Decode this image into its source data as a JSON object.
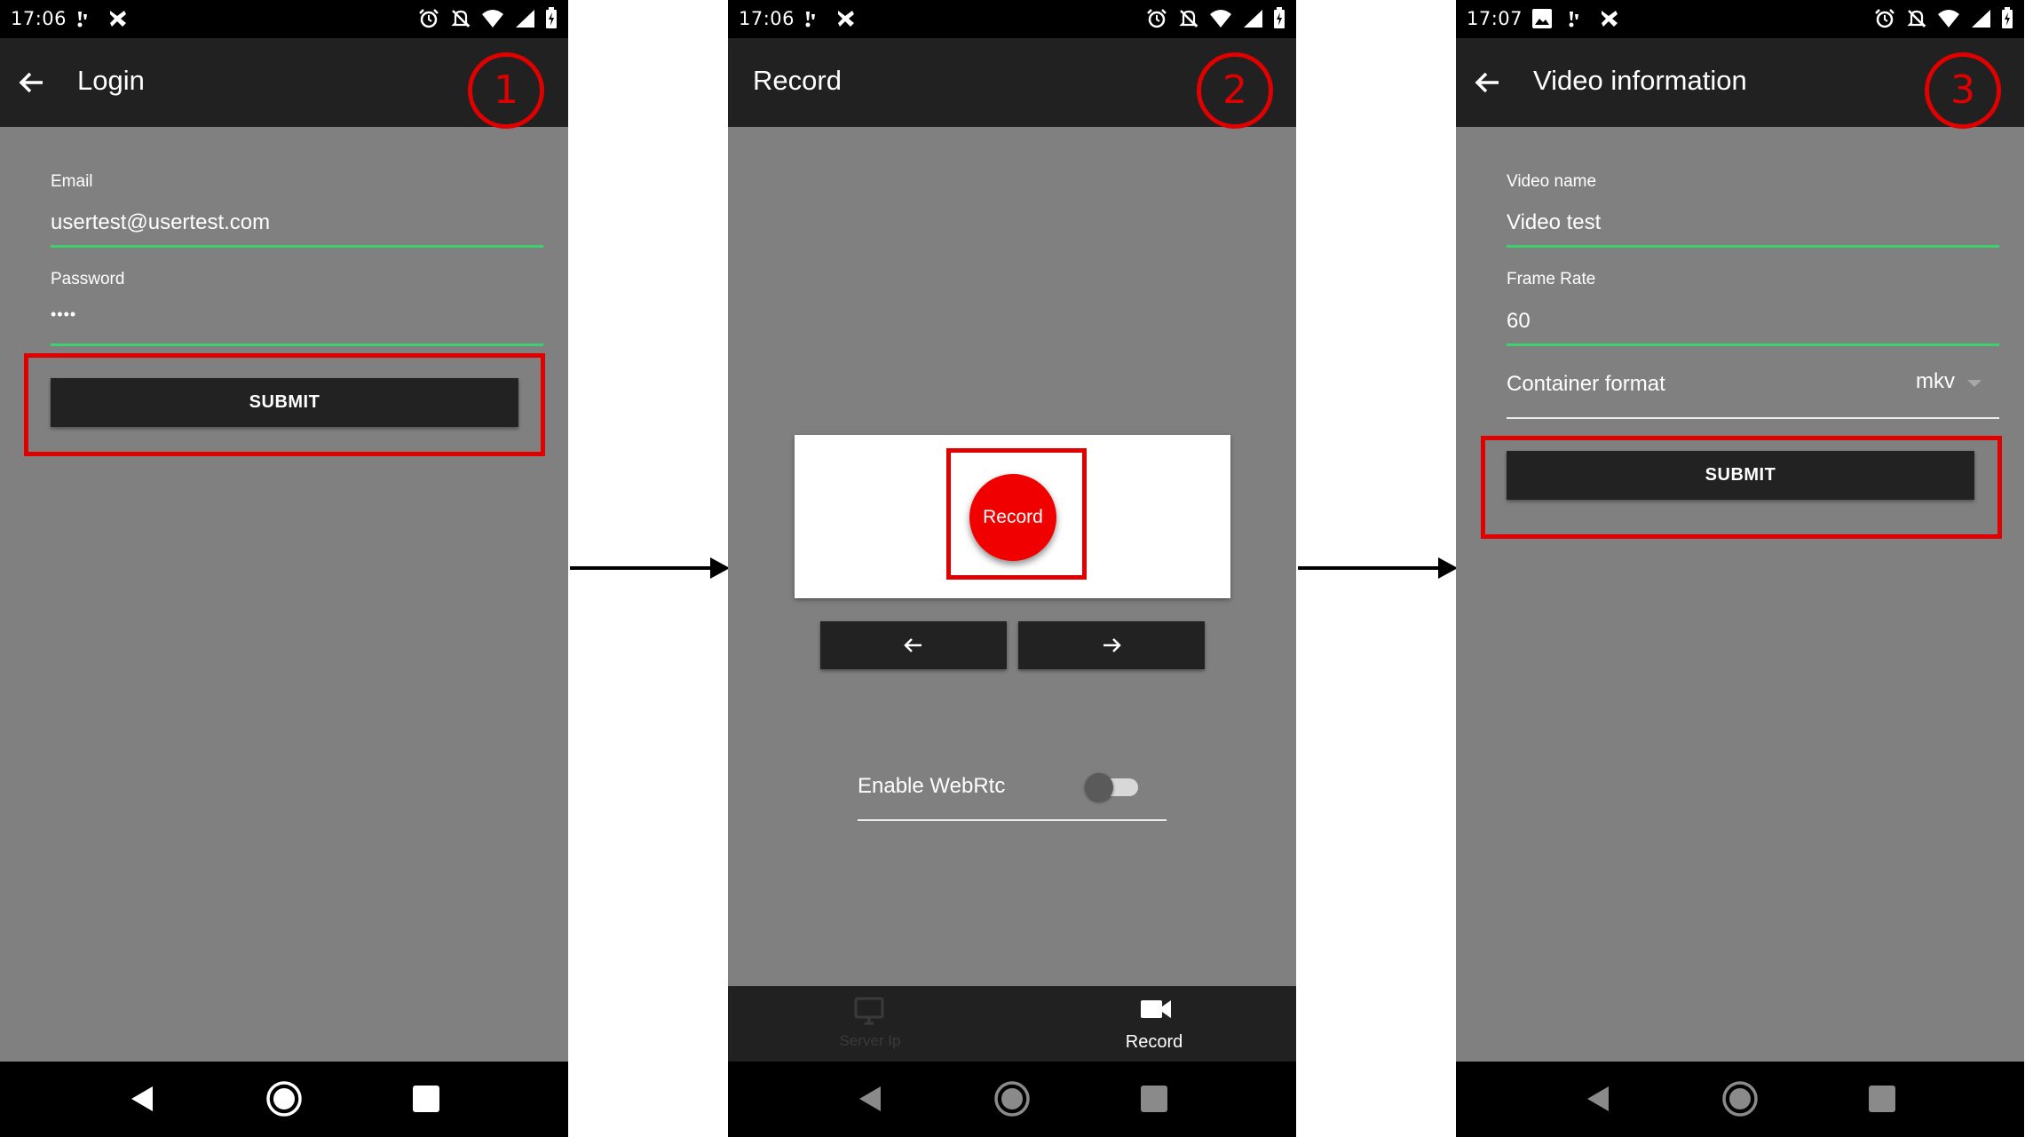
{
  "colors": {
    "accent_green": "#3bd16f",
    "annotation_red": "#e00000",
    "record_red": "#f10000",
    "appbar": "#212121",
    "background": "#808080"
  },
  "screens": [
    {
      "status_time": "17:06",
      "title": "Login",
      "step_number": "1",
      "fields": [
        {
          "label": "Email",
          "value": "usertest@usertest.com"
        },
        {
          "label": "Password",
          "value": "••••"
        }
      ],
      "submit_label": "SUBMIT"
    },
    {
      "status_time": "17:06",
      "title": "Record",
      "step_number": "2",
      "record_label": "Record",
      "toggle_label": "Enable WebRtc",
      "toggle_on": false,
      "bottom_nav": [
        {
          "label": "Server Ip",
          "icon": "monitor-icon",
          "active": false
        },
        {
          "label": "Record",
          "icon": "videocam-icon",
          "active": true
        }
      ]
    },
    {
      "status_time": "17:07",
      "title": "Video information",
      "step_number": "3",
      "fields": [
        {
          "label": "Video name",
          "value": "Video test"
        },
        {
          "label": "Frame Rate",
          "value": "60"
        }
      ],
      "container_format": {
        "label": "Container format",
        "value": "mkv"
      },
      "submit_label": "SUBMIT"
    }
  ]
}
